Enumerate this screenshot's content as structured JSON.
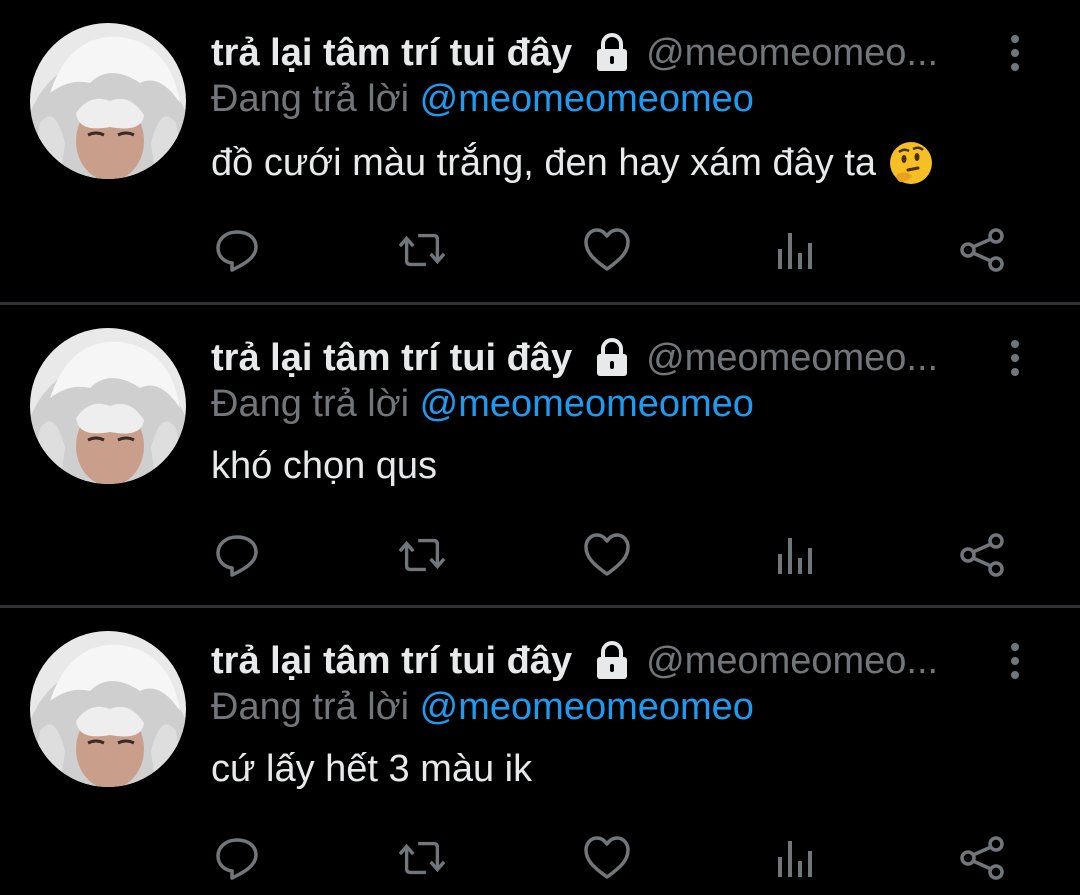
{
  "tweets": [
    {
      "display_name": "trả lại tâm trí tui đây",
      "handle": "@meomeomeo...",
      "replying_prefix": "Đang trả lời",
      "replying_to": "@meomeomeomeo",
      "text": "đồ cưới màu trắng, đen hay xám đây ta",
      "emoji": "thinking-face"
    },
    {
      "display_name": "trả lại tâm trí tui đây",
      "handle": "@meomeomeo...",
      "replying_prefix": "Đang trả lời",
      "replying_to": "@meomeomeomeo",
      "text": "khó chọn qus",
      "emoji": ""
    },
    {
      "display_name": "trả lại tâm trí tui đây",
      "handle": "@meomeomeo...",
      "replying_prefix": "Đang trả lời",
      "replying_to": "@meomeomeomeo",
      "text": "cứ lấy hết 3 màu ik",
      "emoji": ""
    }
  ],
  "icons": {
    "lock": "lock-icon",
    "more": "more-vertical-icon",
    "actions": [
      "reply-icon",
      "retweet-icon",
      "like-icon",
      "views-icon",
      "share-icon"
    ]
  },
  "colors": {
    "background": "#000000",
    "text": "#e7e9ea",
    "secondary": "#71767b",
    "mention": "#1d9bf0",
    "divider": "#2f3336",
    "icon": "#71767b"
  }
}
